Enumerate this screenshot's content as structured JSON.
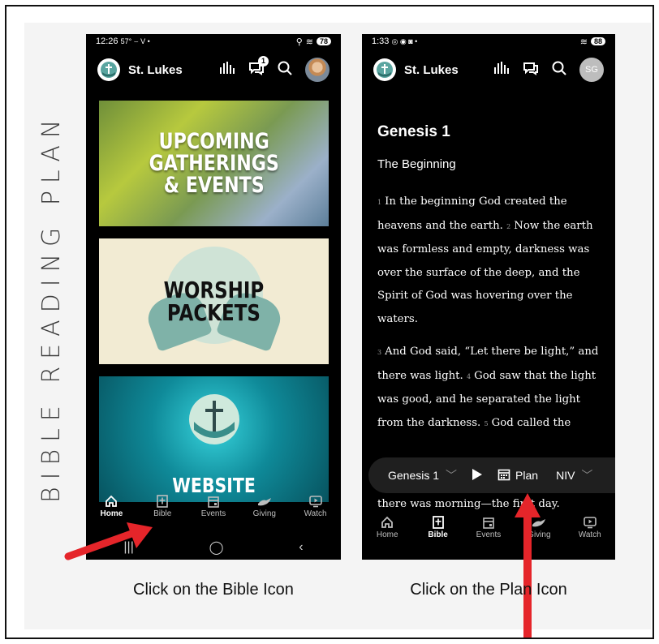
{
  "side_title": "BIBLE READING PLAN",
  "left_phone": {
    "status_time": "12:26",
    "status_extra": "57° ⌣ V •",
    "battery": "78",
    "app_name": "St. Lukes",
    "notification_count": "1",
    "cards": [
      {
        "title_line1": "UPCOMING",
        "title_line2": "GATHERINGS",
        "title_line3": "& EVENTS"
      },
      {
        "title_line1": "WORSHIP",
        "title_line2": "PACKETS"
      },
      {
        "title_line1": "WEBSITE"
      }
    ],
    "tabs": [
      "Home",
      "Bible",
      "Events",
      "Giving",
      "Watch"
    ],
    "active_tab": "Home"
  },
  "right_phone": {
    "status_time": "1:33",
    "status_extra": "◎ ◉ ◙ •",
    "battery": "88",
    "app_name": "St. Lukes",
    "avatar_initials": "SG",
    "chapter_title": "Genesis 1",
    "section_title": "The Beginning",
    "para1": [
      {
        "n": "1",
        "text": "In the beginning God created the heavens and the earth."
      },
      {
        "n": "2",
        "text": "Now the earth was formless and empty, darkness was over the surface of the deep, and the Spirit of God was hovering over the waters."
      }
    ],
    "para2": [
      {
        "n": "3",
        "text": "And God said, “Let there be light,” and there was light."
      },
      {
        "n": "4",
        "text": "God saw that the light was good, and he separated the light from the darkness."
      },
      {
        "n": "5",
        "text": "God called the"
      }
    ],
    "tail_text": "there was morning—the first day.",
    "player": {
      "chapter": "Genesis 1",
      "plan_label": "Plan",
      "version": "NIV"
    },
    "tabs": [
      "Home",
      "Bible",
      "Events",
      "Giving",
      "Watch"
    ],
    "active_tab": "Bible"
  },
  "captions": {
    "left": "Click on the Bible Icon",
    "right": "Click on the Plan Icon"
  },
  "colors": {
    "arrow": "#e5252a",
    "background": "#f4f4f4",
    "phone": "#000000"
  }
}
